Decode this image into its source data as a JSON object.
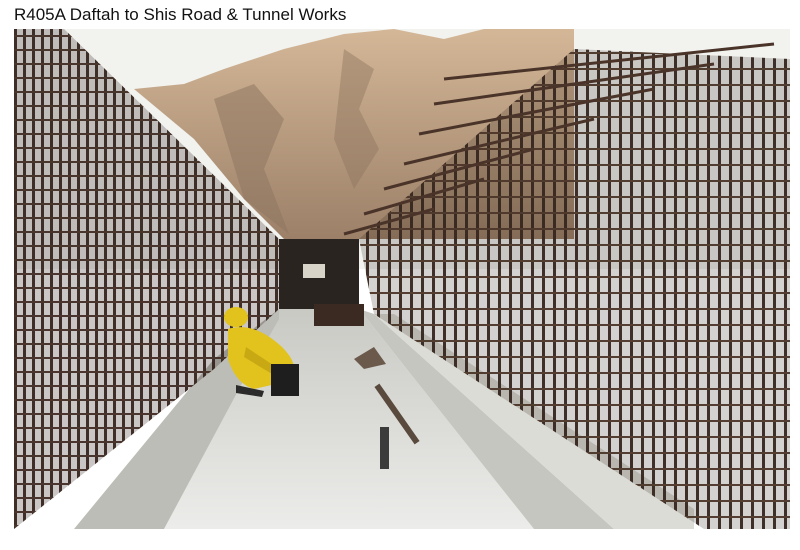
{
  "caption": {
    "text": "R405A Daftah to Shis Road & Tunnel Works"
  },
  "photo": {
    "subject": "rebar-cage-tunnel-construction",
    "colors": {
      "sky": "#f2f2ef",
      "mountain": "#c7a688",
      "mountain_shadow": "#8e7660",
      "rebar": "#3a2a22",
      "rebar_light": "#6a4b3a",
      "concrete": "#d9d9d4",
      "concrete_dark": "#a9a9a3",
      "worker_suit": "#e2c21c"
    }
  }
}
